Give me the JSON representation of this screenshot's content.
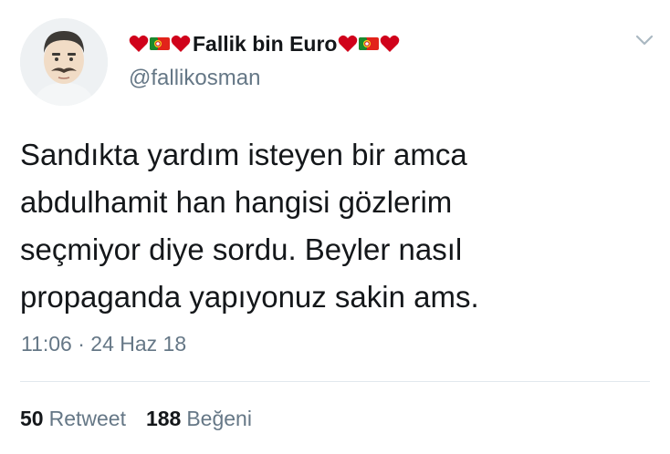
{
  "author": {
    "display_name": "Fallik bin Euro",
    "handle": "@fallikosman",
    "avatar_icon": "avatar-man-mustache-icon",
    "name_prefix_emojis": [
      "heart-icon",
      "portugal-flag-icon",
      "heart-icon"
    ],
    "name_suffix_emojis": [
      "heart-icon",
      "portugal-flag-icon",
      "heart-icon"
    ]
  },
  "tweet": {
    "lines": [
      "Sandıkta yardım isteyen bir amca",
      "abdulhamit han hangisi gözlerim",
      "seçmiyor diye sordu. Beyler nasıl",
      "propaganda yapıyonuz sakin ams."
    ],
    "timestamp": "11:06 · 24 Haz 18"
  },
  "stats": {
    "retweets_count": "50",
    "retweets_label": "Retweet",
    "likes_count": "188",
    "likes_label": "Beğeni"
  },
  "colors": {
    "text_primary": "#14171a",
    "text_secondary": "#657786",
    "divider": "#e1e8ed",
    "heart": "#d0021b"
  }
}
